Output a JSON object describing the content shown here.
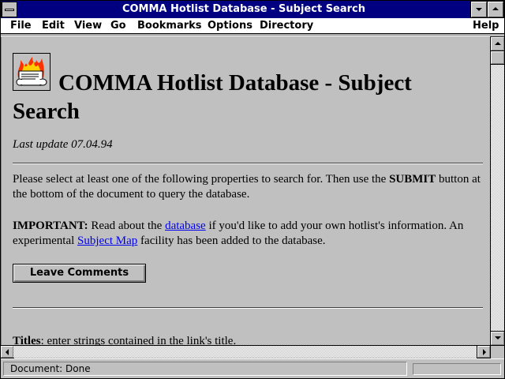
{
  "window": {
    "title": "COMMA Hotlist Database - Subject Search"
  },
  "menubar": {
    "items": [
      {
        "label": "File"
      },
      {
        "label": "Edit"
      },
      {
        "label": "View"
      },
      {
        "label": "Go"
      },
      {
        "label": "Bookmarks"
      },
      {
        "label": "Options"
      },
      {
        "label": "Directory"
      },
      {
        "label": "Help"
      }
    ]
  },
  "page": {
    "heading_line1": "COMMA Hotlist Database - Subject",
    "heading_line2": "Search",
    "last_update": "Last update 07.04.94",
    "para1_text_a": "Please select at least one of the following properties to search for. Then use the ",
    "para1_bold": "SUBMIT",
    "para1_text_b": " button at the bottom of the document to query the database.",
    "important_label": "IMPORTANT:",
    "para2_text_a": " Read about the ",
    "database_link": "database",
    "para2_text_b": " if you'd like to add your own hotlist's information. An experimental ",
    "subject_map_link": "Subject Map",
    "para2_text_c": " facility has been added to the database.",
    "leave_comments_button": "Leave Comments",
    "titles_label": "Titles",
    "titles_text": ": enter strings contained in the link's title."
  },
  "status": {
    "text": "Document: Done"
  },
  "colors": {
    "title_bar": "#000080",
    "link": "#0000ee",
    "background": "#c0c0c0"
  },
  "icons": {
    "logo": "burning-scroll-icon",
    "system_menu": "system-menu-icon",
    "minimize": "minimize-icon",
    "maximize": "maximize-icon"
  }
}
